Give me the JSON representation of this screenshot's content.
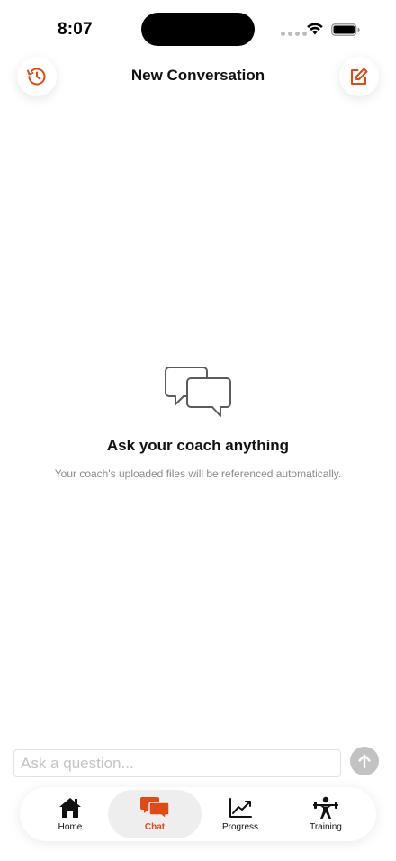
{
  "status_bar": {
    "time": "8:07"
  },
  "header": {
    "title": "New Conversation"
  },
  "empty_state": {
    "title": "Ask your coach anything",
    "subtitle": "Your coach's uploaded files will be referenced automatically."
  },
  "composer": {
    "placeholder": "Ask a question...",
    "value": ""
  },
  "tabs": [
    {
      "label": "Home",
      "icon": "home-icon",
      "active": false
    },
    {
      "label": "Chat",
      "icon": "chat-icon",
      "active": true
    },
    {
      "label": "Progress",
      "icon": "chart-line-icon",
      "active": false
    },
    {
      "label": "Training",
      "icon": "weightlifter-icon",
      "active": false
    }
  ],
  "colors": {
    "accent": "#e04a17",
    "tab_active_bg": "#eeeeee",
    "send_disabled": "#c2c2c2",
    "muted_text": "#8a8a8a"
  }
}
